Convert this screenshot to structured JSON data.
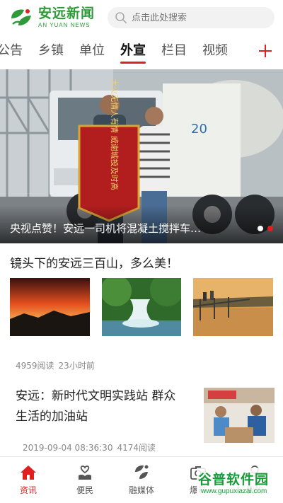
{
  "header": {
    "logo_cn": "安远新闻",
    "logo_en": "AN YUAN NEWS",
    "search_placeholder": "点击此处搜索"
  },
  "tabs": [
    {
      "label": "公告"
    },
    {
      "label": "乡镇"
    },
    {
      "label": "单位"
    },
    {
      "label": "外宣",
      "active": true
    },
    {
      "label": "栏目"
    },
    {
      "label": "视频"
    }
  ],
  "banner": {
    "caption": "央视点赞！安远一司机将混凝土搅拌车…",
    "banner_text": "大火无情人有情 威谢城投及时高",
    "truck_label": "20"
  },
  "gallery": {
    "title": "镜头下的安远三百山，多么美！",
    "reads": "4959阅读",
    "time": "23小时前"
  },
  "article": {
    "title": "安远：新时代文明实践站 群众生活的加油站",
    "datetime": "2019-09-04 08:36:30",
    "reads": "4174阅读"
  },
  "bottom_nav": [
    {
      "label": "资讯",
      "icon": "home-icon",
      "active": true
    },
    {
      "label": "便民",
      "icon": "heart-hand-icon"
    },
    {
      "label": "融媒体",
      "icon": "leaf-logo-icon"
    },
    {
      "label": "爆料",
      "icon": "camera-icon"
    },
    {
      "label": "我的",
      "icon": "user-icon"
    }
  ],
  "watermark": {
    "text": "谷普软件园",
    "url": "www.gupuxiazai.com"
  },
  "colors": {
    "brand_green": "#2f9a3a",
    "accent_red": "#e02020"
  }
}
